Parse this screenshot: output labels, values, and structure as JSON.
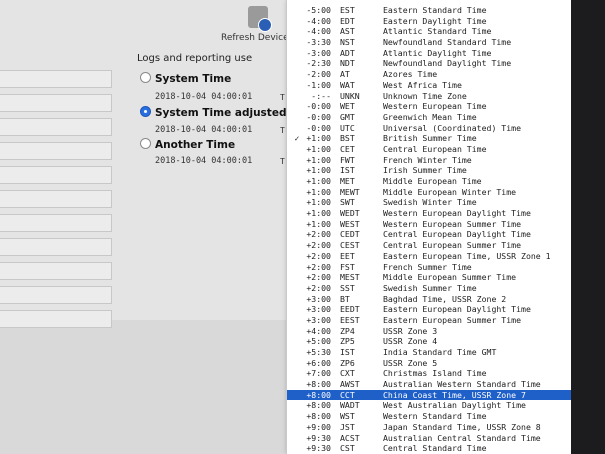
{
  "dialog": {
    "refresh_label": "Refresh Device Li",
    "group_title": "Logs and reporting use",
    "options": [
      {
        "label": "System Time",
        "selected": false,
        "date": "2018-10-04 04:00:01",
        "tz": "T"
      },
      {
        "label": "System Time adjusted for an",
        "selected": true,
        "date": "2018-10-04 04:00:01",
        "tz": "T"
      },
      {
        "label": "Another Time",
        "selected": false,
        "date": "2018-10-04 04:00:01",
        "tz": "T"
      }
    ]
  },
  "menu": {
    "selected_index": 36,
    "checked_index": 12,
    "items": [
      {
        "offset": "-5:00",
        "abbr": "EST",
        "name": "Eastern Standard Time"
      },
      {
        "offset": "-4:00",
        "abbr": "EDT",
        "name": "Eastern Daylight Time"
      },
      {
        "offset": "-4:00",
        "abbr": "AST",
        "name": "Atlantic Standard Time"
      },
      {
        "offset": "-3:30",
        "abbr": "NST",
        "name": "Newfoundland Standard Time"
      },
      {
        "offset": "-3:00",
        "abbr": "ADT",
        "name": "Atlantic Daylight Time"
      },
      {
        "offset": "-2:30",
        "abbr": "NDT",
        "name": "Newfoundland Daylight Time"
      },
      {
        "offset": "-2:00",
        "abbr": "AT",
        "name": "Azores Time"
      },
      {
        "offset": "-1:00",
        "abbr": "WAT",
        "name": "West Africa Time"
      },
      {
        "offset": "-:--",
        "abbr": "UNKN",
        "name": "Unknown Time Zone"
      },
      {
        "offset": "-0:00",
        "abbr": "WET",
        "name": "Western European Time"
      },
      {
        "offset": "-0:00",
        "abbr": "GMT",
        "name": "Greenwich Mean Time"
      },
      {
        "offset": "-0:00",
        "abbr": "UTC",
        "name": "Universal (Coordinated) Time"
      },
      {
        "offset": "+1:00",
        "abbr": "BST",
        "name": "British Summer Time"
      },
      {
        "offset": "+1:00",
        "abbr": "CET",
        "name": "Central European Time"
      },
      {
        "offset": "+1:00",
        "abbr": "FWT",
        "name": "French Winter Time"
      },
      {
        "offset": "+1:00",
        "abbr": "IST",
        "name": "Irish Summer Time"
      },
      {
        "offset": "+1:00",
        "abbr": "MET",
        "name": "Middle European Time"
      },
      {
        "offset": "+1:00",
        "abbr": "MEWT",
        "name": "Middle European Winter Time"
      },
      {
        "offset": "+1:00",
        "abbr": "SWT",
        "name": "Swedish Winter Time"
      },
      {
        "offset": "+1:00",
        "abbr": "WEDT",
        "name": "Western European Daylight Time"
      },
      {
        "offset": "+1:00",
        "abbr": "WEST",
        "name": "Western European Summer Time"
      },
      {
        "offset": "+2:00",
        "abbr": "CEDT",
        "name": "Central European Daylight Time"
      },
      {
        "offset": "+2:00",
        "abbr": "CEST",
        "name": "Central European Summer Time"
      },
      {
        "offset": "+2:00",
        "abbr": "EET",
        "name": "Eastern European Time, USSR Zone 1"
      },
      {
        "offset": "+2:00",
        "abbr": "FST",
        "name": "French Summer Time"
      },
      {
        "offset": "+2:00",
        "abbr": "MEST",
        "name": "Middle European Summer Time"
      },
      {
        "offset": "+2:00",
        "abbr": "SST",
        "name": "Swedish Summer Time"
      },
      {
        "offset": "+3:00",
        "abbr": "BT",
        "name": "Baghdad Time, USSR Zone 2"
      },
      {
        "offset": "+3:00",
        "abbr": "EEDT",
        "name": "Eastern European Daylight Time"
      },
      {
        "offset": "+3:00",
        "abbr": "EEST",
        "name": "Eastern European Summer Time"
      },
      {
        "offset": "+4:00",
        "abbr": "ZP4",
        "name": "USSR Zone 3"
      },
      {
        "offset": "+5:00",
        "abbr": "ZP5",
        "name": "USSR Zone 4"
      },
      {
        "offset": "+5:30",
        "abbr": "IST",
        "name": "India Standard Time GMT"
      },
      {
        "offset": "+6:00",
        "abbr": "ZP6",
        "name": "USSR Zone 5"
      },
      {
        "offset": "+7:00",
        "abbr": "CXT",
        "name": "Christmas Island Time"
      },
      {
        "offset": "+8:00",
        "abbr": "AWST",
        "name": "Australian Western Standard Time"
      },
      {
        "offset": "+8:00",
        "abbr": "CCT",
        "name": "China Coast Time, USSR Zone 7"
      },
      {
        "offset": "+8:00",
        "abbr": "WADT",
        "name": "West Australian Daylight Time"
      },
      {
        "offset": "+8:00",
        "abbr": "WST",
        "name": "Western Standard Time"
      },
      {
        "offset": "+9:00",
        "abbr": "JST",
        "name": "Japan Standard Time, USSR Zone 8"
      },
      {
        "offset": "+9:30",
        "abbr": "ACST",
        "name": "Australian Central Standard Time"
      },
      {
        "offset": "+9:30",
        "abbr": "CST",
        "name": "Central Standard Time"
      }
    ]
  }
}
